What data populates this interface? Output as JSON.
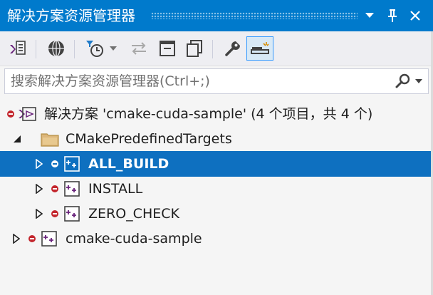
{
  "window": {
    "title": "解决方案资源管理器",
    "controls": {
      "dropdown": "▼",
      "pin": "📌",
      "close": "✕"
    }
  },
  "colors": {
    "accent": "#007acc",
    "selection": "#0e70c0",
    "error_badge": "#c3262d",
    "folder": "#dcb67a",
    "vs_purple": "#68217a"
  },
  "toolbar": {
    "tools": [
      {
        "name": "switch-views-icon"
      },
      {
        "name": "globe-icon"
      },
      {
        "name": "pending-changes-filter-icon"
      },
      {
        "name": "dropdown-arrow-icon"
      },
      {
        "name": "sync-with-active-document-icon"
      },
      {
        "name": "collapse-all-icon"
      },
      {
        "name": "show-all-files-icon"
      },
      {
        "name": "properties-wrench-icon"
      },
      {
        "name": "preview-selected-items-icon"
      }
    ]
  },
  "search": {
    "placeholder": "搜索解决方案资源管理器(Ctrl+;)"
  },
  "tree": {
    "items": [
      {
        "label": "解决方案 'cmake-cuda-sample'  (4 个项目，共 4 个)",
        "type": "solution",
        "expanded": true,
        "level": 0,
        "selected": false
      },
      {
        "label": "CMakePredefinedTargets",
        "type": "folder",
        "expanded": true,
        "level": 1,
        "selected": false
      },
      {
        "label": "ALL_BUILD",
        "type": "project",
        "expanded": false,
        "level": 2,
        "selected": true
      },
      {
        "label": "INSTALL",
        "type": "project",
        "expanded": false,
        "level": 2,
        "selected": false
      },
      {
        "label": "ZERO_CHECK",
        "type": "project",
        "expanded": false,
        "level": 2,
        "selected": false
      },
      {
        "label": "cmake-cuda-sample",
        "type": "project",
        "expanded": false,
        "level": 0,
        "selected": false
      }
    ]
  }
}
